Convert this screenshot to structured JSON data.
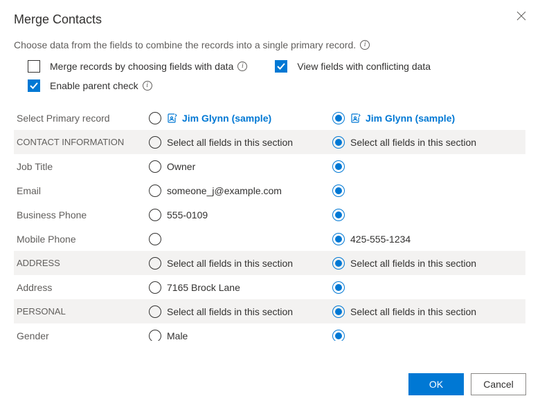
{
  "dialog": {
    "title": "Merge Contacts",
    "subtitle": "Choose data from the fields to combine the records into a single primary record."
  },
  "options": {
    "merge_by_fields": {
      "label": "Merge records by choosing fields with data",
      "checked": false
    },
    "view_conflicting": {
      "label": "View fields with conflicting data",
      "checked": true
    },
    "enable_parent_check": {
      "label": "Enable parent check",
      "checked": true
    }
  },
  "primary_row": {
    "label": "Select Primary record",
    "left_name": "Jim Glynn (sample)",
    "right_name": "Jim Glynn (sample)",
    "selected": "right"
  },
  "section_select_all": "Select all fields in this section",
  "sections": [
    {
      "header": "CONTACT INFORMATION",
      "fields": [
        {
          "label": "Job Title",
          "left": "Owner",
          "right": ""
        },
        {
          "label": "Email",
          "left": "someone_j@example.com",
          "right": ""
        },
        {
          "label": "Business Phone",
          "left": "555-0109",
          "right": ""
        },
        {
          "label": "Mobile Phone",
          "left": "",
          "right": "425-555-1234"
        }
      ]
    },
    {
      "header": "ADDRESS",
      "fields": [
        {
          "label": "Address",
          "left": "7165 Brock Lane",
          "right": ""
        }
      ]
    },
    {
      "header": "PERSONAL",
      "fields": [
        {
          "label": "Gender",
          "left": "Male",
          "right": ""
        }
      ]
    }
  ],
  "footer": {
    "ok": "OK",
    "cancel": "Cancel"
  }
}
